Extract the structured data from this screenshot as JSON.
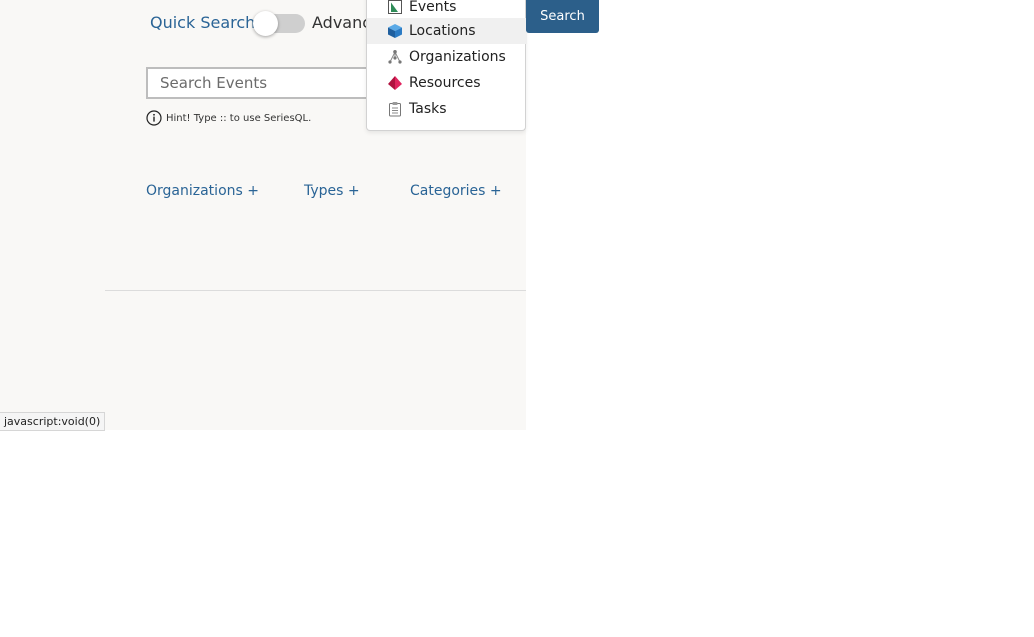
{
  "search_mode": {
    "quick_label": "Quick Search",
    "advanced_label": "Advanced"
  },
  "search": {
    "placeholder": "Search Events",
    "hint": "Hint! Type :: to use SeriesQL.",
    "button_label": "Search"
  },
  "filters": {
    "organizations": "Organizations +",
    "types": "Types +",
    "categories": "Categories +"
  },
  "object_menu": {
    "items": [
      {
        "label": "Events",
        "icon": "events-icon"
      },
      {
        "label": "Locations",
        "icon": "locations-cube-icon",
        "active": true
      },
      {
        "label": "Organizations",
        "icon": "organizations-tree-icon"
      },
      {
        "label": "Resources",
        "icon": "resources-pyramid-icon"
      },
      {
        "label": "Tasks",
        "icon": "tasks-clipboard-icon"
      }
    ]
  },
  "status_bar": {
    "text": "javascript:void(0)"
  },
  "colors": {
    "link": "#2a6496",
    "button": "#2c5f8a",
    "panel_bg": "#f9f8f6"
  }
}
